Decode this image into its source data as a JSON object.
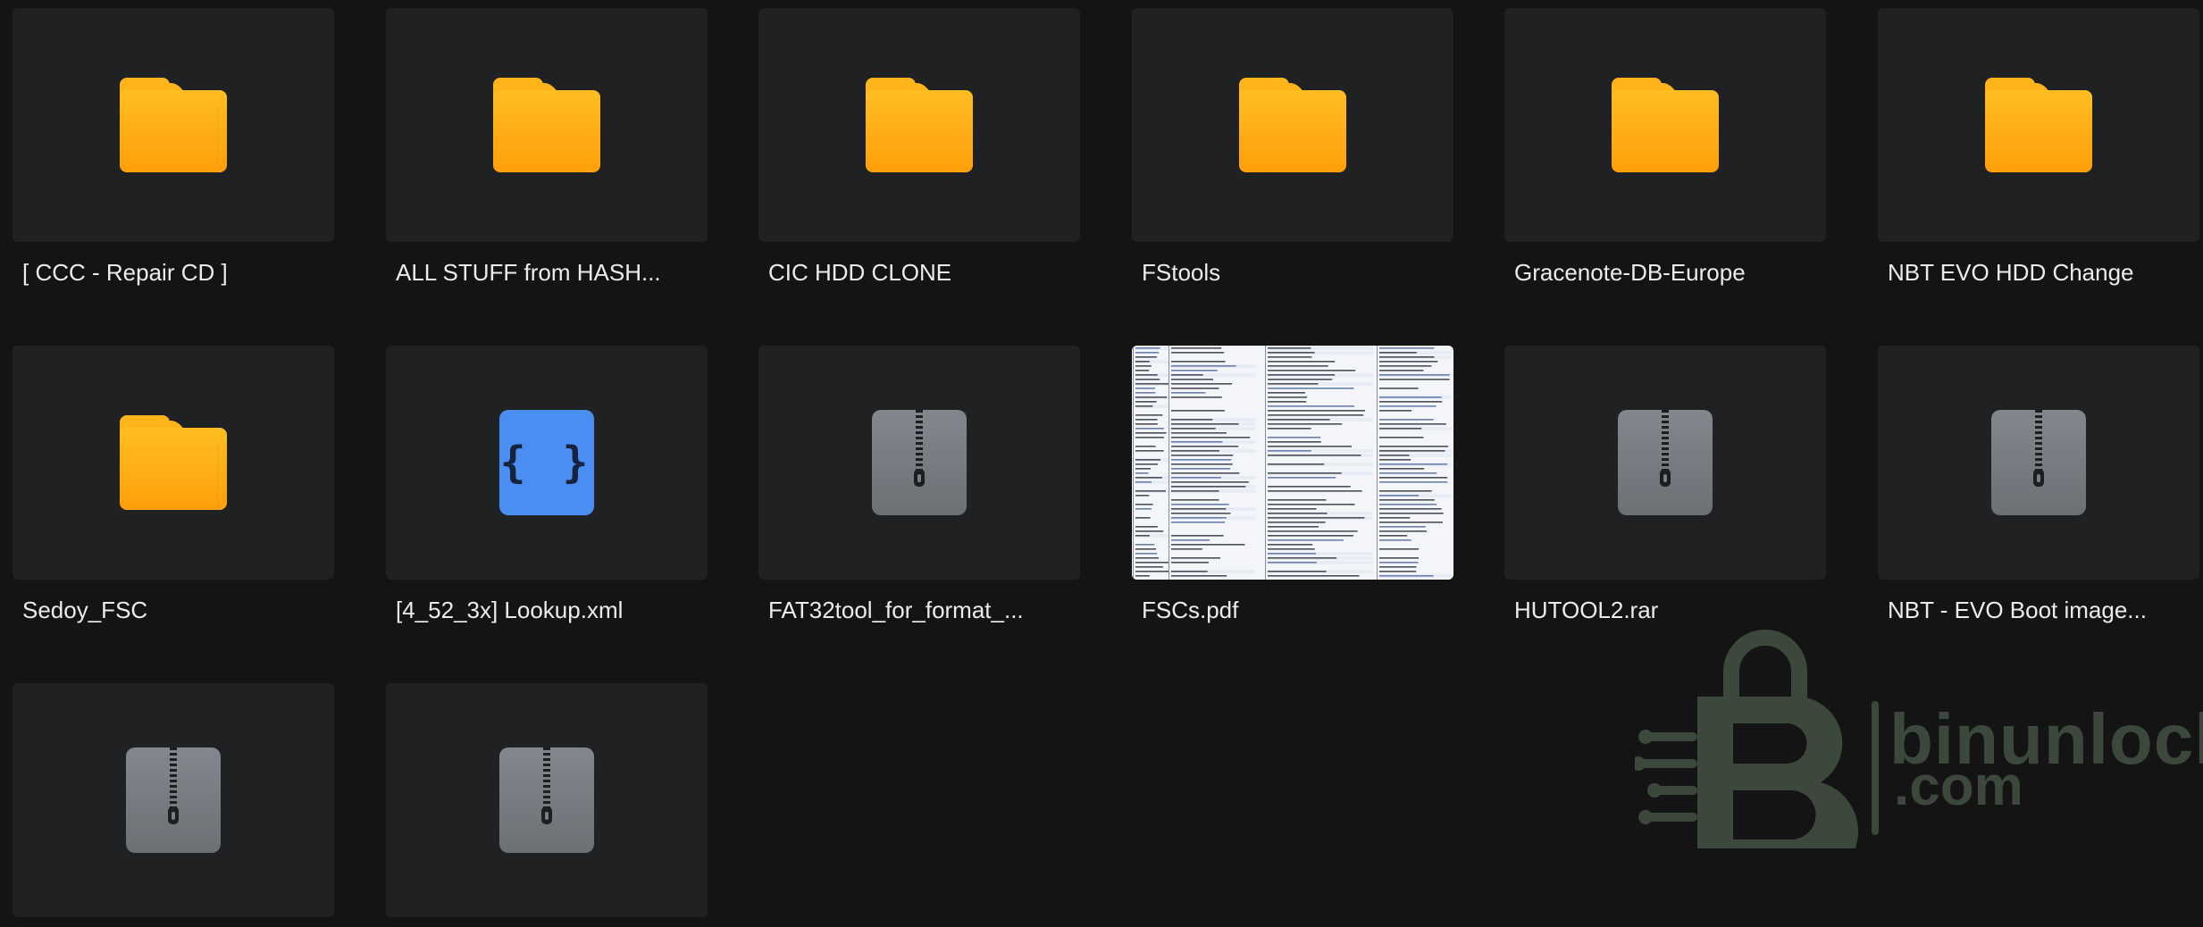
{
  "items": [
    {
      "name": "[ CCC - Repair CD ]",
      "type": "folder"
    },
    {
      "name": "ALL STUFF from HASH...",
      "type": "folder"
    },
    {
      "name": "CIC HDD CLONE",
      "type": "folder"
    },
    {
      "name": "FStools",
      "type": "folder"
    },
    {
      "name": "Gracenote-DB-Europe",
      "type": "folder"
    },
    {
      "name": "NBT EVO HDD Change",
      "type": "folder"
    },
    {
      "name": "Sedoy_FSC",
      "type": "folder"
    },
    {
      "name": "[4_52_3x] Lookup.xml",
      "type": "xml"
    },
    {
      "name": "FAT32tool_for_format_...",
      "type": "archive"
    },
    {
      "name": "FSCs.pdf",
      "type": "pdf"
    },
    {
      "name": "HUTOOL2.rar",
      "type": "archive"
    },
    {
      "name": "NBT - EVO Boot image...",
      "type": "archive"
    },
    {
      "name": "",
      "type": "archive"
    },
    {
      "name": "",
      "type": "archive"
    }
  ],
  "xml_glyph": "{ }",
  "watermark": {
    "line1": "binunlock",
    "line2": ".com",
    "color": "#5f7460"
  },
  "colors": {
    "background": "#141414",
    "tile": "#202123",
    "folder": "#ffb419",
    "xml": "#4a8ef4",
    "archive": "#7b7e83"
  }
}
